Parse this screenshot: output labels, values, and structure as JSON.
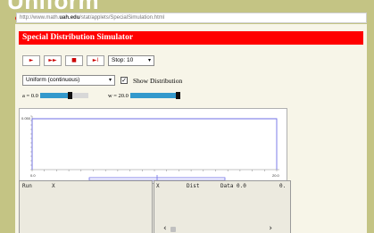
{
  "slide": {
    "title": "Uniform"
  },
  "browser": {
    "url_prefix": "http://www.math.",
    "url_domain": "uah.edu",
    "url_suffix": "/stat/applets/SpecialSimulation.html"
  },
  "app": {
    "header": "Special Distribution Simulator"
  },
  "toolbar": {
    "buttons": [
      {
        "name": "step-button",
        "icon": "►"
      },
      {
        "name": "run-button",
        "icon": "►►"
      },
      {
        "name": "stop-button",
        "icon": "■"
      },
      {
        "name": "reset-button",
        "icon": "►I"
      }
    ],
    "stop_select": "Stop: 10",
    "dropdown_arrow": "▾"
  },
  "distribution": {
    "selected": "Uniform (continuous)",
    "show_label": "Show Distribution",
    "show_checked": "✓"
  },
  "params": {
    "a_label": "a = 0.0",
    "w_label": "w = 20.0",
    "a_value": 0.0,
    "w_value": 20.0
  },
  "graph": {
    "y_tick": "0.050",
    "x_min_label": "0.0",
    "x_max_label": "20.0"
  },
  "table_left": {
    "col1": "Run",
    "col2": "X"
  },
  "table_right": {
    "col1": "X",
    "col2": "Dist",
    "col3": "Data 0.0",
    "col4": "0."
  },
  "scroll": {
    "left_arrow": "‹",
    "right_arrow": "›"
  },
  "colors": {
    "slide_bg": "#c4c484",
    "header_red": "#ff0000",
    "graph_line": "#6e6ee6",
    "slider_blue": "#3399cc"
  }
}
